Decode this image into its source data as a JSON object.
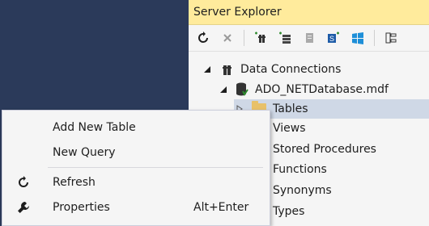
{
  "panel": {
    "title": "Server Explorer"
  },
  "toolbar": {
    "buttons": [
      {
        "icon": "refresh-icon"
      },
      {
        "icon": "stop-icon"
      },
      {
        "icon": "connect-to-database-icon"
      },
      {
        "icon": "connect-to-server-icon"
      },
      {
        "icon": "connect-to-sharepoint-icon"
      },
      {
        "icon": "connect-to-azure-icon"
      },
      {
        "icon": "windows-azure-icon"
      },
      {
        "icon": "filter-icon"
      }
    ]
  },
  "tree": {
    "data_connections": "Data Connections",
    "database": "ADO_NETDatabase.mdf",
    "folders": [
      "Tables",
      "Views",
      "Stored Procedures",
      "Functions",
      "Synonyms",
      "Types"
    ]
  },
  "context_menu": {
    "items": [
      {
        "label": "Add New Table",
        "shortcut": "",
        "icon": ""
      },
      {
        "label": "New Query",
        "shortcut": "",
        "icon": ""
      },
      {
        "label": "Refresh",
        "shortcut": "",
        "icon": "refresh-icon"
      },
      {
        "label": "Properties",
        "shortcut": "Alt+Enter",
        "icon": "wrench-icon"
      }
    ]
  },
  "colors": {
    "title_bar": "#ffeb9c",
    "left_pane": "#2b3a5a",
    "selection": "#cfd8e6",
    "folder": "#e8c169"
  }
}
